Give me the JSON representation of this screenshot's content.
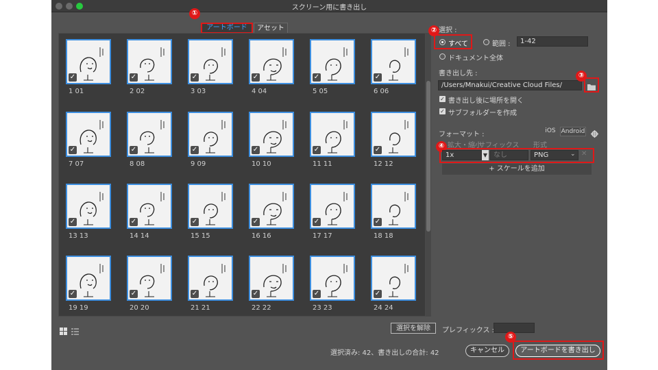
{
  "window": {
    "title": "スクリーン用に書き出し"
  },
  "tabs": {
    "artboard": "アートボード",
    "asset": "アセット"
  },
  "badges": [
    "①",
    "②",
    "③",
    "④",
    "⑤"
  ],
  "thumbnails": [
    {
      "label": "1   01"
    },
    {
      "label": "2   02"
    },
    {
      "label": "3   03"
    },
    {
      "label": "4   04"
    },
    {
      "label": "5   05"
    },
    {
      "label": "6   06"
    },
    {
      "label": "7   07"
    },
    {
      "label": "8   08"
    },
    {
      "label": "9   09"
    },
    {
      "label": "10  10"
    },
    {
      "label": "11  11"
    },
    {
      "label": "12  12"
    },
    {
      "label": "13  13"
    },
    {
      "label": "14  14"
    },
    {
      "label": "15  15"
    },
    {
      "label": "16  16"
    },
    {
      "label": "17  17"
    },
    {
      "label": "18  18"
    },
    {
      "label": "19  19"
    },
    {
      "label": "20  20"
    },
    {
      "label": "21  21"
    },
    {
      "label": "22  22"
    },
    {
      "label": "23  23"
    },
    {
      "label": "24  24"
    }
  ],
  "selection": {
    "label": "選択 :",
    "all": "すべて",
    "range": "範囲 :",
    "range_value": "1-42",
    "whole_document": "ドキュメント全体"
  },
  "export_to": {
    "label": "書き出し先 :",
    "path": "/Users/Mnakui/Creative Cloud Files/",
    "open_after": "書き出し後に場所を開く",
    "create_subfolders": "サブフォルダーを作成"
  },
  "format": {
    "label": "フォーマット :",
    "ios": "iOS",
    "android": "Android",
    "col_scale": "拡大・縮小",
    "col_suffix": "サフィックス",
    "col_format": "形式",
    "scale_value": "1x",
    "suffix_placeholder": "なし",
    "format_value": "PNG",
    "add_scale": "+ スケールを追加"
  },
  "bottom": {
    "deselect": "選択を解除",
    "prefix_label": "プレフィックス :",
    "status": "選択済み: 42、書き出しの合計: 42",
    "cancel": "キャンセル",
    "export": "アートボードを書き出し"
  }
}
